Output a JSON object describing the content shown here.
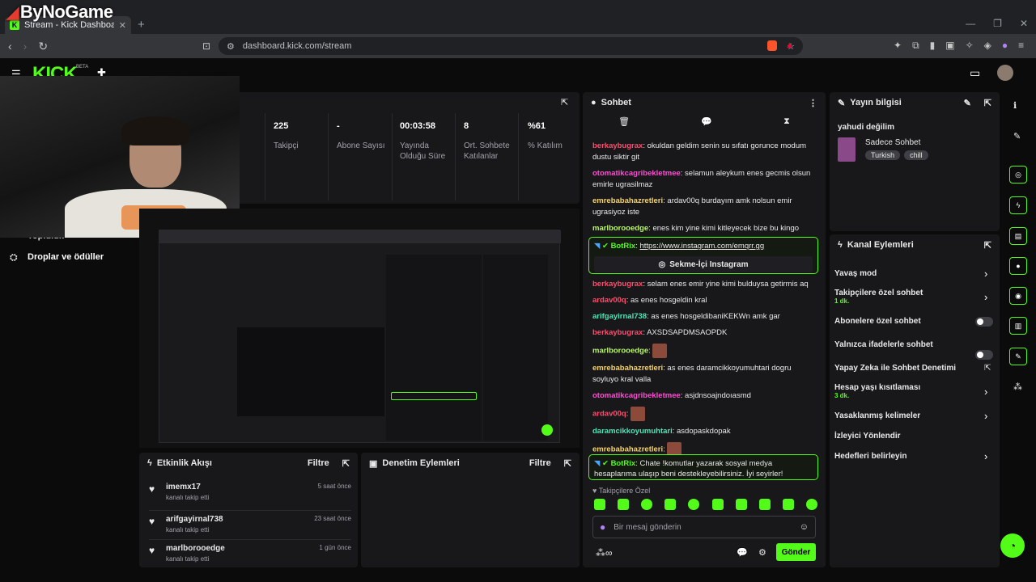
{
  "watermark": "ByNoGame",
  "browser": {
    "tab_title": "Stream - Kick Dashboard",
    "url": "dashboard.kick.com/stream"
  },
  "app": {
    "logo": "KICK",
    "beta": "BETA"
  },
  "sidebar": {
    "items": [
      {
        "label": "Topluluk"
      },
      {
        "label": "Droplar ve ödüller"
      }
    ]
  },
  "stats": [
    {
      "value": "225",
      "label": "Takipçi"
    },
    {
      "value": "-",
      "label": "Abone Sayısı"
    },
    {
      "value": "00:03:58",
      "label": "Yayında Olduğu Süre"
    },
    {
      "value": "8",
      "label": "Ort. Sohbete Katılanlar"
    },
    {
      "value": "%61",
      "label": "% Katılım"
    }
  ],
  "activity": {
    "title": "Etkinlik Akışı",
    "filter": "Filtre",
    "items": [
      {
        "user": "imemx17",
        "action": "kanalı takip etti",
        "time": "5 saat önce"
      },
      {
        "user": "arifgayirnal738",
        "action": "kanalı takip etti",
        "time": "23 saat önce"
      },
      {
        "user": "marlborooedge",
        "action": "kanalı takip etti",
        "time": "1 gün önce"
      }
    ]
  },
  "moderation": {
    "title": "Denetim Eylemleri",
    "filter": "Filtre"
  },
  "chat": {
    "title": "Sohbet",
    "messages": [
      {
        "user": "berkaybugrax",
        "color": "#ff4d6d",
        "text": "okuldan geldim senin su sıfatı gorunce modum dustu siktir git"
      },
      {
        "user": "otomatikcagribekletmee",
        "color": "#ff4dd2",
        "text": "selamun aleykum enes gecmis olsun emirle ugrasilmaz"
      },
      {
        "user": "emrebabahazretleri",
        "color": "#f5d36b",
        "text": "ardav00q burdayım amk nolsun emir ugrasiyoz iste"
      },
      {
        "user": "marlborooedge",
        "color": "#b8f56b",
        "text": "enes kim yine kimi kitleyecek bize bu kingo"
      }
    ],
    "bot1": {
      "user": "BotRix",
      "text": "https://www.instagram.com/emqrr.gg",
      "button": "Sekme-İçi Instagram"
    },
    "messages2": [
      {
        "user": "berkaybugrax",
        "color": "#ff4d6d",
        "text": "selam enes emir yine kimi bulduysa getirmis aq"
      },
      {
        "user": "ardav00q",
        "color": "#ff4d6d",
        "text": "as enes hosgeldin kral"
      },
      {
        "user": "arifgayirnal738",
        "color": "#4de6b8",
        "text": "as enes hosgeldibaniKEKWn amk gar"
      },
      {
        "user": "berkaybugrax",
        "color": "#ff4d6d",
        "text": "AXSDSAPDMSAOPDK"
      },
      {
        "user": "marlborooedge",
        "color": "#b8f56b",
        "text": "",
        "emote": true
      },
      {
        "user": "emrebabahazretleri",
        "color": "#f5d36b",
        "text": "as enes daramcikkoyumuhtari dogru soyluyo kral valla"
      },
      {
        "user": "otomatikcagribekletmee",
        "color": "#ff4dd2",
        "text": "asjdnsoajndoıasmd"
      },
      {
        "user": "ardav00q",
        "color": "#ff4d6d",
        "text": "",
        "emote": true
      },
      {
        "user": "daramcikkoyumuhtari",
        "color": "#4de6b8",
        "text": "asdopaskdopak"
      },
      {
        "user": "emrebabahazretleri",
        "color": "#f5d36b",
        "text": "",
        "emote": true
      }
    ],
    "bot2": {
      "user": "BotRix",
      "text": "Chate !komutlar yazarak sosyal medya hesaplarıma ulaşıp beni destekleyebilirsiniz. İyi seyirler!"
    },
    "followers_only": "Takipçilere Özel",
    "placeholder": "Bir mesaj gönderin",
    "send": "Gönder"
  },
  "stream_info": {
    "title": "Yayın bilgisi",
    "stream_title": "yahudi değilim",
    "category": "Sadece Sohbet",
    "tags": [
      "Turkish",
      "chill"
    ]
  },
  "channel_actions": {
    "title": "Kanal Eylemleri",
    "items": [
      {
        "label": "Yavaş mod",
        "control": "chevron"
      },
      {
        "label": "Takipçilere özel sohbet",
        "sub": "1 dk.",
        "control": "chevron"
      },
      {
        "label": "Abonelere özel sohbet",
        "control": "toggle"
      },
      {
        "label": "Yalnızca ifadelerle sohbet",
        "control": "toggle"
      },
      {
        "label": "Yapay Zeka ile Sohbet Denetimi",
        "control": "external"
      },
      {
        "label": "Hesap yaşı kısıtlaması",
        "sub": "3 dk.",
        "control": "chevron"
      },
      {
        "label": "Yasaklanmış kelimeler",
        "control": "chevron"
      },
      {
        "label": "İzleyici Yönlendir",
        "control": "none"
      },
      {
        "label": "Hedefleri belirleyin",
        "control": "chevron"
      }
    ]
  },
  "colors": {
    "accent": "#53fc18",
    "panel": "#18181b",
    "background": "#0b0b0c"
  }
}
